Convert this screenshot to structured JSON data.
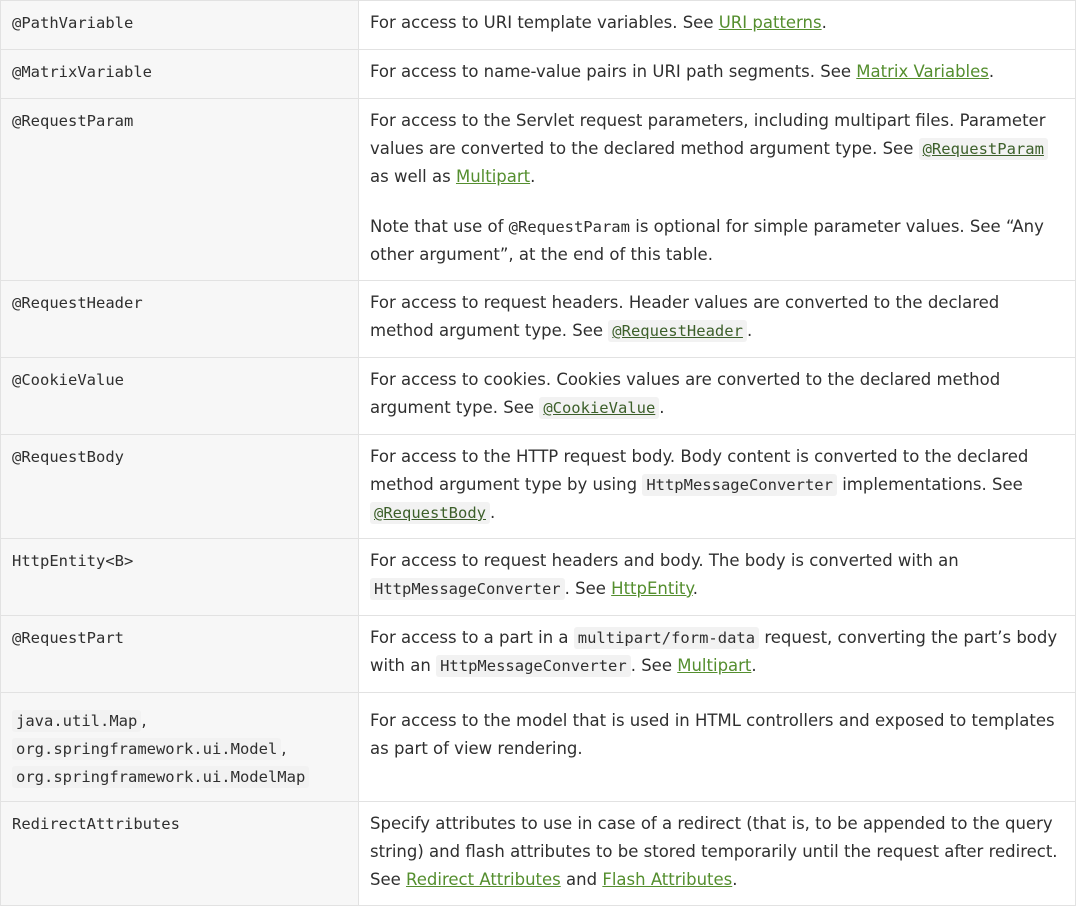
{
  "colors": {
    "link": "#548e2e",
    "code_link": "#3c5f2a",
    "left_cell_background": "#f7f7f7",
    "border": "#e2e2e2",
    "code_background": "#f2f2f2"
  },
  "rows": [
    {
      "arg": "@PathVariable",
      "desc": {
        "t1": "For access to URI template variables. See ",
        "link1": "URI patterns",
        "t2": "."
      }
    },
    {
      "arg": "@MatrixVariable",
      "desc": {
        "t1": "For access to name-value pairs in URI path segments. See ",
        "link1": "Matrix Variables",
        "t2": "."
      }
    },
    {
      "arg": "@RequestParam",
      "desc": {
        "t1": "For access to the Servlet request parameters, including multipart files. Parameter values are converted to the declared method argument type. See ",
        "code_link": "@RequestParam",
        "t2": " as well as ",
        "link1": "Multipart",
        "t3": ".",
        "p2_t1": "Note that use of ",
        "p2_code": "@RequestParam",
        "p2_t2": " is optional for simple parameter values. See “Any other argument”, at the end of this table."
      }
    },
    {
      "arg": "@RequestHeader",
      "desc": {
        "t1": "For access to request headers. Header values are converted to the declared method argument type. See ",
        "code_link": "@RequestHeader",
        "t2": "."
      }
    },
    {
      "arg": "@CookieValue",
      "desc": {
        "t1": "For access to cookies. Cookies values are converted to the declared method argument type. See ",
        "code_link": "@CookieValue",
        "t2": "."
      }
    },
    {
      "arg": "@RequestBody",
      "desc": {
        "t1": "For access to the HTTP request body. Body content is converted to the declared method argument type by using ",
        "code": "HttpMessageConverter",
        "t2": " implementations. See ",
        "code_link": "@RequestBody",
        "t3": "."
      }
    },
    {
      "arg": "HttpEntity<B>",
      "desc": {
        "t1": "For access to request headers and body. The body is converted with an ",
        "code": "HttpMessageConverter",
        "t2": ". See ",
        "link1": "HttpEntity",
        "t3": "."
      }
    },
    {
      "arg": "@RequestPart",
      "desc": {
        "t1": "For access to a part in a ",
        "code": "multipart/form-data",
        "t2": " request, converting the part’s body with an ",
        "code2": "HttpMessageConverter",
        "t3": ". See ",
        "link1": "Multipart",
        "t4": "."
      }
    },
    {
      "arg_lines": [
        "java.util.Map",
        "org.springframework.ui.Model",
        "org.springframework.ui.ModelMap"
      ],
      "desc": {
        "t1": "For access to the model that is used in HTML controllers and exposed to templates as part of view rendering."
      }
    },
    {
      "arg": "RedirectAttributes",
      "desc": {
        "t1": "Specify attributes to use in case of a redirect (that is, to be appended to the query string) and flash attributes to be stored temporarily until the request after redirect. See ",
        "link1": "Redirect Attributes",
        "t2": " and ",
        "link2": "Flash Attributes",
        "t3": "."
      }
    }
  ]
}
